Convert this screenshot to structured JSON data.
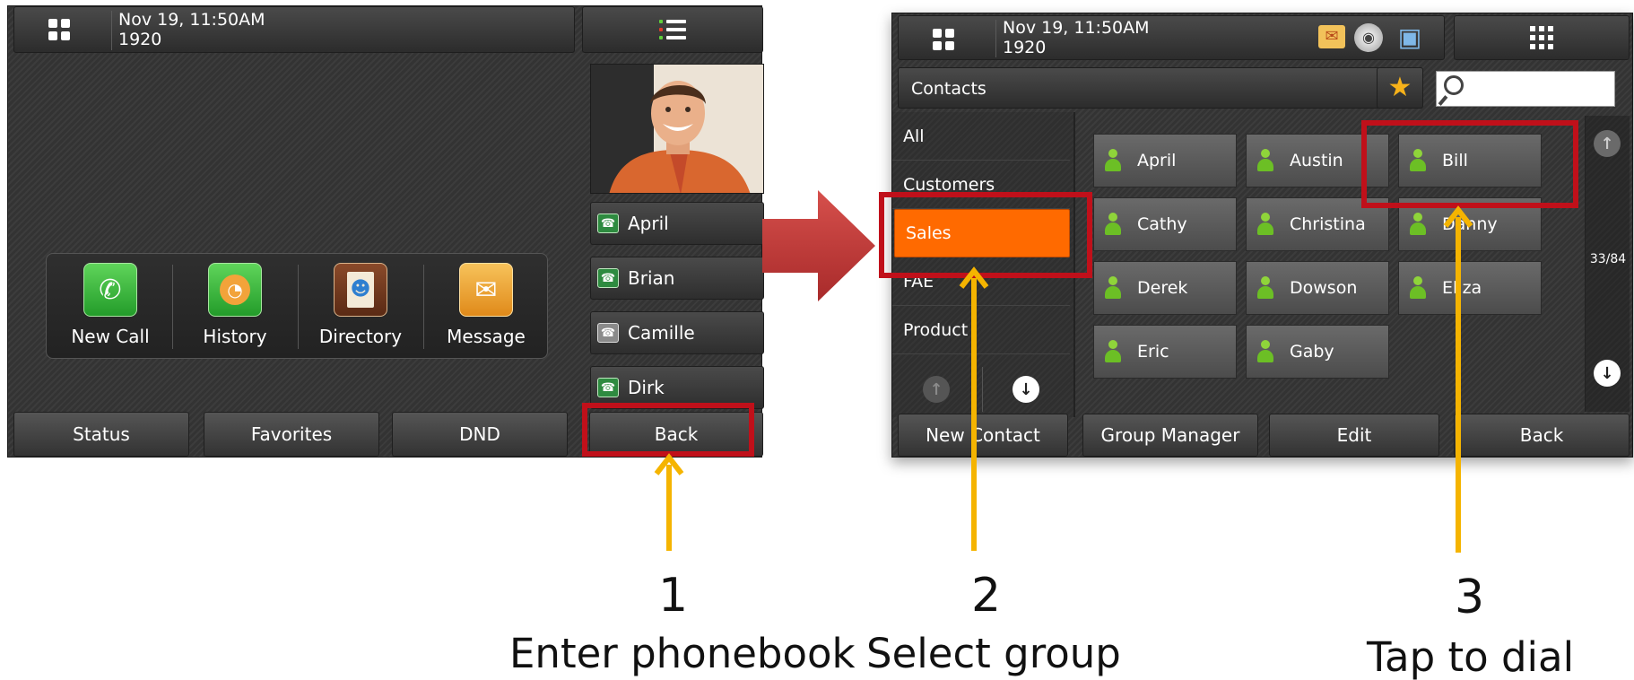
{
  "status_bar": {
    "date": "Nov 19, 11:50AM",
    "extension": "1920"
  },
  "apps": [
    {
      "label": "New Call",
      "icon": "handset-icon"
    },
    {
      "label": "History",
      "icon": "history-icon"
    },
    {
      "label": "Directory",
      "icon": "directory-icon"
    },
    {
      "label": "Message",
      "icon": "message-icon"
    }
  ],
  "favorites": [
    {
      "label": "April",
      "icon_status": "online"
    },
    {
      "label": "Brian",
      "icon_status": "online"
    },
    {
      "label": "Camille",
      "icon_status": "offline"
    },
    {
      "label": "Dirk",
      "icon_status": "online"
    }
  ],
  "home_softkeys": {
    "status": "Status",
    "favorites": "Favorites",
    "dnd": "DND",
    "back": "Back"
  },
  "phonebook": {
    "title": "Contacts",
    "search_placeholder": "",
    "groups": [
      "All",
      "Customers",
      "Sales",
      "FAE",
      "Product"
    ],
    "selected_group": "Sales",
    "contacts": [
      "April",
      "Austin",
      "Bill",
      "Cathy",
      "Christina",
      "Danny",
      "Derek",
      "Dowson",
      "Eliza",
      "Eric",
      "Gaby"
    ],
    "page_indicator": "33/84",
    "softkeys": {
      "new_contact": "New Contact",
      "group_manager": "Group Manager",
      "edit": "Edit",
      "back": "Back"
    }
  },
  "steps": [
    {
      "number": "1",
      "caption": "Enter phonebook"
    },
    {
      "number": "2",
      "caption": "Select group"
    },
    {
      "number": "3",
      "caption": "Tap to dial"
    }
  ],
  "colors": {
    "highlight_box": "#c0101a",
    "pointer_arrow": "#f5b400",
    "transition_arrow": "#c63a3a",
    "selected_group": "#ff6a00"
  }
}
